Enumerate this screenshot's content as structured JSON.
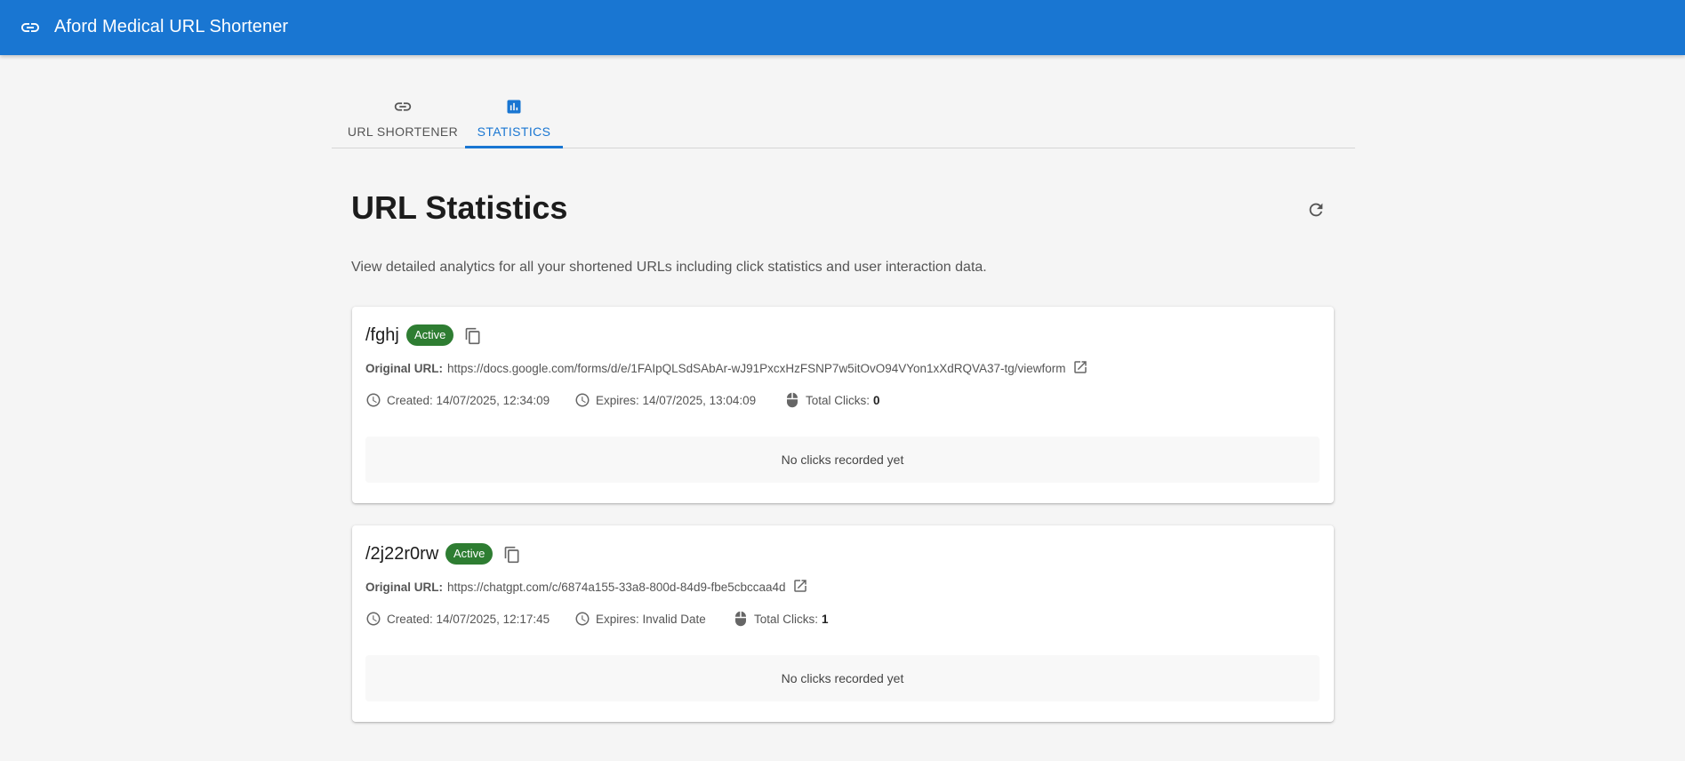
{
  "appbar": {
    "title": "Aford Medical URL Shortener",
    "icon": "link-icon",
    "color": "#1976d2"
  },
  "tabs": [
    {
      "label": "URL SHORTENER",
      "icon": "link-icon",
      "active": false
    },
    {
      "label": "STATISTICS",
      "icon": "bar-chart-icon",
      "active": true
    }
  ],
  "page": {
    "title": "URL Statistics",
    "subtitle": "View detailed analytics for all your shortened URLs including click statistics and user interaction data.",
    "refresh_icon": "refresh-icon"
  },
  "urls": [
    {
      "code": "/fghj",
      "status": "Active",
      "original_label": "Original URL:",
      "original_url": "https://docs.google.com/forms/d/e/1FAIpQLSdSAbAr-wJ91PxcxHzFSNP7w5itOvO94VYon1xXdRQVA37-tg/viewform",
      "created": "Created: 14/07/2025, 12:34:09",
      "expires": "Expires: 14/07/2025, 13:04:09",
      "clicks_label": "Total Clicks:",
      "clicks": "0",
      "empty": "No clicks recorded yet"
    },
    {
      "code": "/2j22r0rw",
      "status": "Active",
      "original_label": "Original URL:",
      "original_url": "https://chatgpt.com/c/6874a155-33a8-800d-84d9-fbe5cbccaa4d",
      "created": "Created: 14/07/2025, 12:17:45",
      "expires": "Expires: Invalid Date",
      "clicks_label": "Total Clicks:",
      "clicks": "1",
      "empty": "No clicks recorded yet"
    }
  ],
  "colors": {
    "active_badge": "#2e7d32",
    "accent": "#1976d2"
  }
}
